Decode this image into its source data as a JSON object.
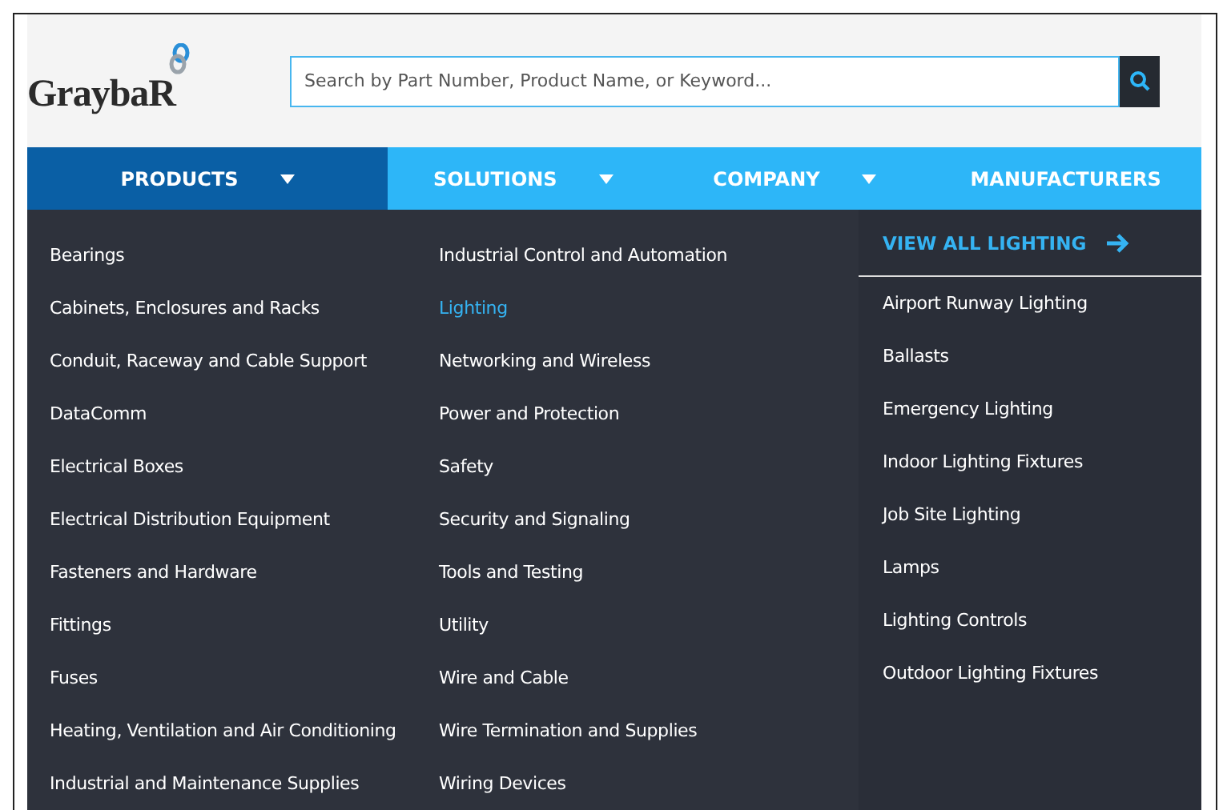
{
  "logo": {
    "text": "GraybaR"
  },
  "search": {
    "placeholder": "Search by Part Number, Product Name, or Keyword..."
  },
  "nav": [
    {
      "label": "PRODUCTS",
      "has_menu": true,
      "selected": true
    },
    {
      "label": "SOLUTIONS",
      "has_menu": true,
      "selected": false
    },
    {
      "label": "COMPANY",
      "has_menu": true,
      "selected": false
    },
    {
      "label": "MANUFACTURERS",
      "has_menu": false,
      "selected": false
    }
  ],
  "categories_1": [
    {
      "label": "Bearings",
      "selected": false
    },
    {
      "label": "Cabinets, Enclosures and Racks",
      "selected": false
    },
    {
      "label": "Conduit, Raceway and Cable Support",
      "selected": false
    },
    {
      "label": "DataComm",
      "selected": false
    },
    {
      "label": "Electrical Boxes",
      "selected": false
    },
    {
      "label": "Electrical Distribution Equipment",
      "selected": false
    },
    {
      "label": "Fasteners and Hardware",
      "selected": false
    },
    {
      "label": "Fittings",
      "selected": false
    },
    {
      "label": "Fuses",
      "selected": false
    },
    {
      "label": "Heating, Ventilation and Air Conditioning",
      "selected": false
    },
    {
      "label": "Industrial and Maintenance Supplies",
      "selected": false
    }
  ],
  "categories_2": [
    {
      "label": "Industrial Control and Automation",
      "selected": false
    },
    {
      "label": "Lighting",
      "selected": true
    },
    {
      "label": "Networking and Wireless",
      "selected": false
    },
    {
      "label": "Power and Protection",
      "selected": false
    },
    {
      "label": "Safety",
      "selected": false
    },
    {
      "label": "Security and Signaling",
      "selected": false
    },
    {
      "label": "Tools and Testing",
      "selected": false
    },
    {
      "label": "Utility",
      "selected": false
    },
    {
      "label": "Wire and Cable",
      "selected": false
    },
    {
      "label": "Wire Termination and Supplies",
      "selected": false
    },
    {
      "label": "Wiring Devices",
      "selected": false
    }
  ],
  "subcategories": {
    "view_all": "VIEW ALL LIGHTING",
    "items": [
      "Airport Runway Lighting",
      "Ballasts",
      "Emergency Lighting",
      "Indoor Lighting Fixtures",
      "Job Site Lighting",
      "Lamps",
      "Lighting Controls",
      "Outdoor Lighting Fixtures"
    ]
  }
}
